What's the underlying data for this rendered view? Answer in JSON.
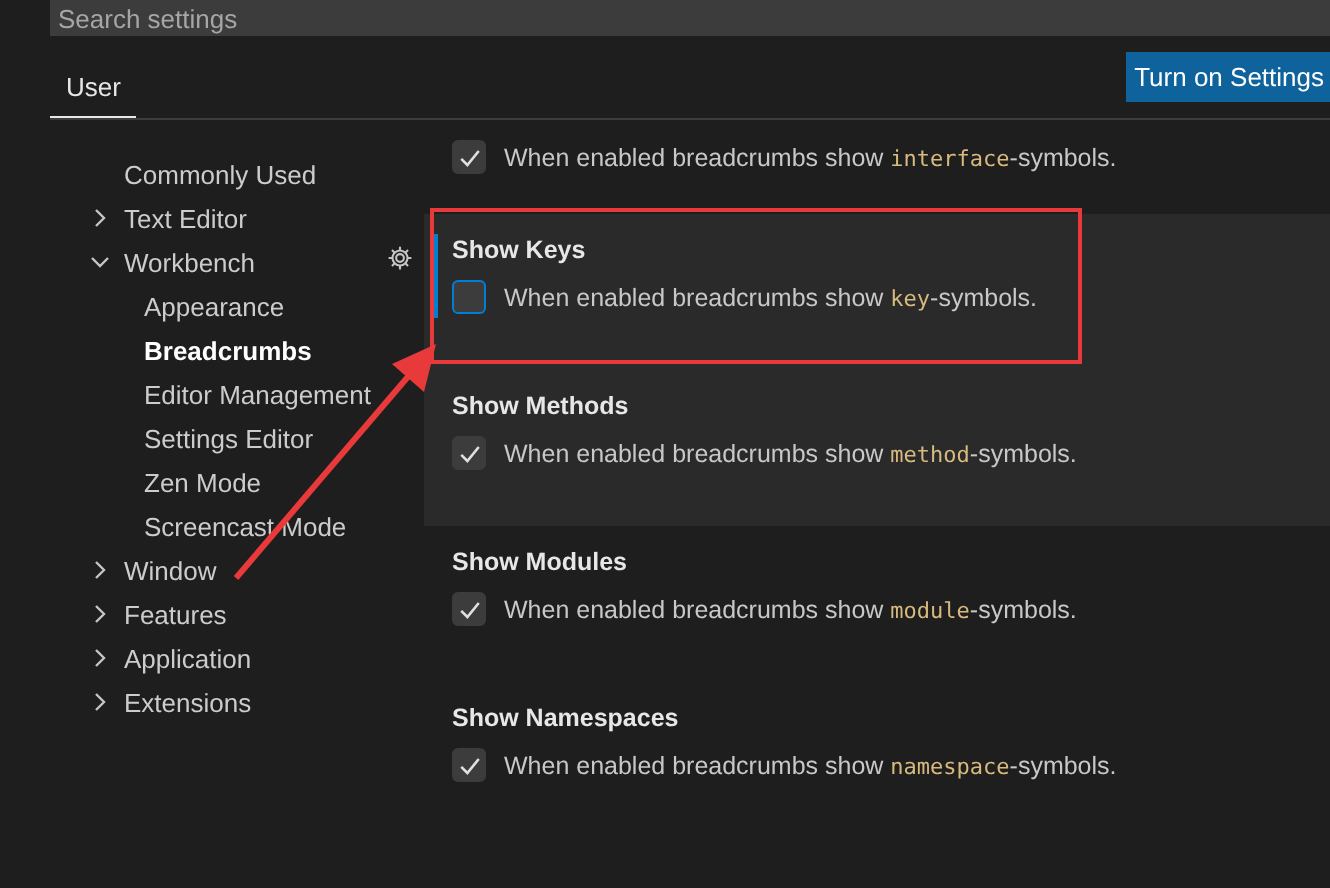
{
  "search": {
    "placeholder": "Search settings"
  },
  "tabs": [
    {
      "label": "User",
      "selected": true
    }
  ],
  "sync_button": {
    "label": "Turn on Settings"
  },
  "tree": [
    {
      "label": "Commonly Used",
      "selected": false
    },
    {
      "label": "Text Editor",
      "expanded": false,
      "selected": false
    },
    {
      "label": "Workbench",
      "expanded": true,
      "selected": false,
      "children": [
        {
          "label": "Appearance",
          "selected": false
        },
        {
          "label": "Breadcrumbs",
          "selected": true
        },
        {
          "label": "Editor Management",
          "selected": false
        },
        {
          "label": "Settings Editor",
          "selected": false
        },
        {
          "label": "Zen Mode",
          "selected": false
        },
        {
          "label": "Screencast Mode",
          "selected": false
        }
      ]
    },
    {
      "label": "Window",
      "expanded": false,
      "selected": false
    },
    {
      "label": "Features",
      "expanded": false,
      "selected": false
    },
    {
      "label": "Application",
      "expanded": false,
      "selected": false
    },
    {
      "label": "Extensions",
      "expanded": false,
      "selected": false
    }
  ],
  "settings": [
    {
      "checked": true,
      "focused": false,
      "hovered": false,
      "highlighted": false,
      "description": {
        "before": "When enabled breadcrumbs show ",
        "code": "interface",
        "after": "-symbols."
      }
    },
    {
      "title": "Show Keys",
      "checked": false,
      "focused": true,
      "hovered": false,
      "highlighted": true,
      "description": {
        "before": "When enabled breadcrumbs show ",
        "code": "key",
        "after": "-symbols."
      }
    },
    {
      "title": "Show Methods",
      "checked": true,
      "focused": false,
      "hovered": true,
      "highlighted": false,
      "description": {
        "before": "When enabled breadcrumbs show ",
        "code": "method",
        "after": "-symbols."
      }
    },
    {
      "title": "Show Modules",
      "checked": true,
      "focused": false,
      "hovered": false,
      "highlighted": false,
      "description": {
        "before": "When enabled breadcrumbs show ",
        "code": "module",
        "after": "-symbols."
      }
    },
    {
      "title": "Show Namespaces",
      "checked": true,
      "focused": false,
      "hovered": false,
      "highlighted": false,
      "description": {
        "before": "When enabled breadcrumbs show ",
        "code": "namespace",
        "after": "-symbols."
      }
    }
  ]
}
